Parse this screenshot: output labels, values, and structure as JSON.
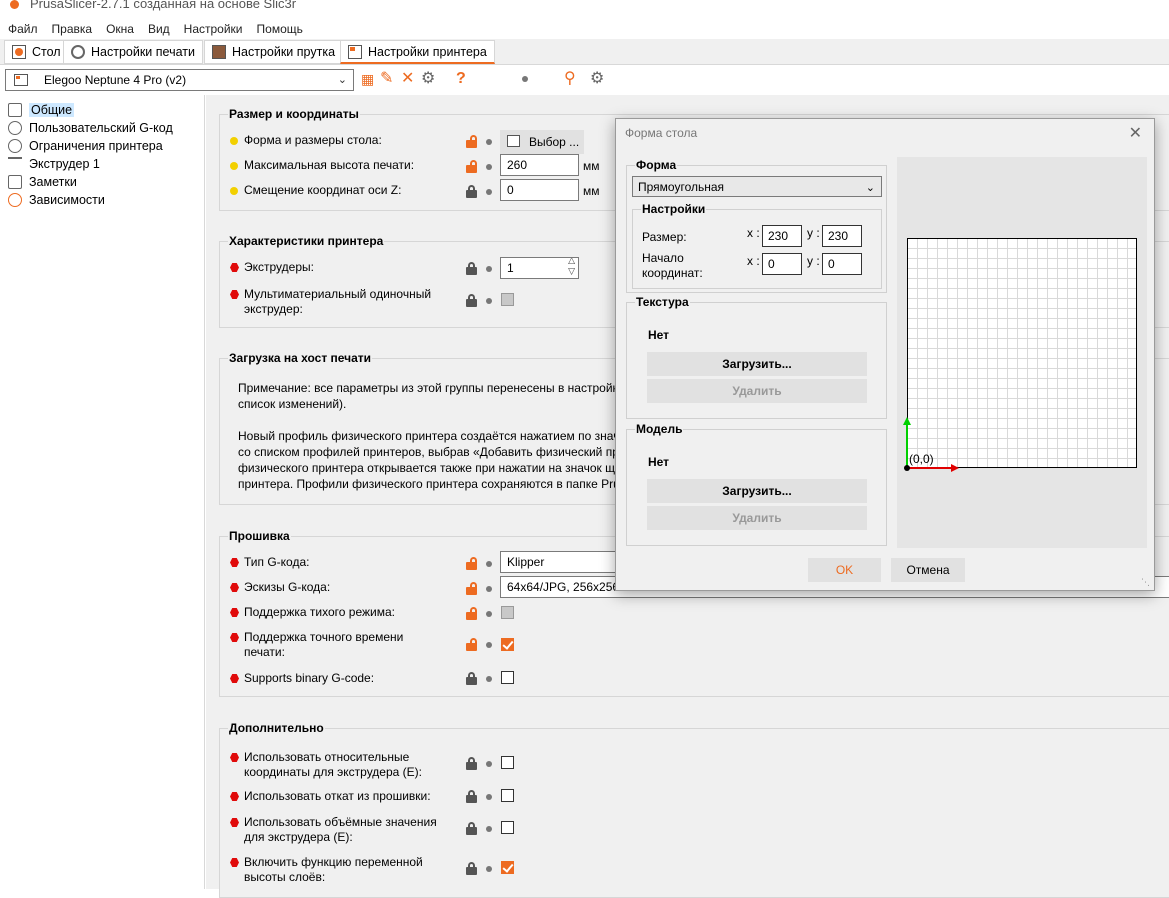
{
  "app": {
    "title": "PrusaSlicer-2.7.1 созданная на основе Slic3r"
  },
  "menu": [
    "Файл",
    "Правка",
    "Окна",
    "Вид",
    "Настройки",
    "Помощь"
  ],
  "tabs": [
    "Стол",
    "Настройки печати",
    "Настройки прутка",
    "Настройки принтера"
  ],
  "preset": {
    "name": "Elegoo Neptune 4 Pro (v2)"
  },
  "tree": [
    "Общие",
    "Пользовательский G-код",
    "Ограничения принтера",
    "Экструдер 1",
    "Заметки",
    "Зависимости"
  ],
  "groups": {
    "size": {
      "title": "Размер и координаты",
      "bed_shape": "Форма и размеры стола:",
      "bed_shape_button": "Выбор ...",
      "max_height": "Максимальная высота печати:",
      "max_height_value": "260",
      "z_offset": "Смещение координат оси Z:",
      "z_offset_value": "0",
      "unit": "мм"
    },
    "printer": {
      "title": "Характеристики принтера",
      "extruders": "Экструдеры:",
      "extruders_value": "1",
      "mmu_line1": "Мультиматериальный одиночный",
      "mmu_line2": "экструдер:"
    },
    "host": {
      "title": "Загрузка на хост печати",
      "note_lines": [
        "Примечание: все параметры из этой группы перенесены в настройк",
        "список изменений).",
        "",
        "Новый профиль физического принтера создаётся нажатием по знач",
        "со списком профилей принтеров, выбрав «Добавить физический пр",
        "физического принтера открывается также при нажатии на значок щ",
        "принтера. Профили физического принтера сохраняются в папке Pru"
      ]
    },
    "firmware": {
      "title": "Прошивка",
      "gcode_flavor": "Тип G-кода:",
      "gcode_flavor_value": "Klipper",
      "thumbnails": "Эскизы G-кода:",
      "thumbnails_value": "64x64/JPG, 256x256/PNG",
      "silent_mode": "Поддержка тихого режима:",
      "time_line1": "Поддержка точного времени",
      "time_line2": "печати:",
      "binary": "Supports binary G-code:"
    },
    "advanced": {
      "title": "Дополнительно",
      "rel_e_line1": "Использовать относительные",
      "rel_e_line2": "координаты для экструдера (E):",
      "fw_retract": "Использовать откат из прошивки:",
      "vol_e_line1": "Использовать объёмные значения",
      "vol_e_line2": "для экструдера (E):",
      "vlh_line1": "Включить функцию переменной",
      "vlh_line2": "высоты слоёв:"
    }
  },
  "dialog": {
    "title": "Форма стола",
    "shape_title": "Форма",
    "shape_value": "Прямоугольная",
    "settings_title": "Настройки",
    "size_label": "Размер:",
    "origin_line1": "Начало",
    "origin_line2": "координат:",
    "x_label": "x :",
    "y_label": "y :",
    "size_x": "230",
    "size_y": "230",
    "origin_x": "0",
    "origin_y": "0",
    "texture_title": "Текстура",
    "texture_none": "Нет",
    "model_title": "Модель",
    "model_none": "Нет",
    "load": "Загрузить...",
    "remove": "Удалить",
    "origin_label": "(0,0)",
    "ok": "OK",
    "cancel": "Отмена"
  },
  "colors": {
    "accent": "#ed6b21",
    "mode_yellow": "#f2d000",
    "mode_red": "#e00a0a"
  }
}
